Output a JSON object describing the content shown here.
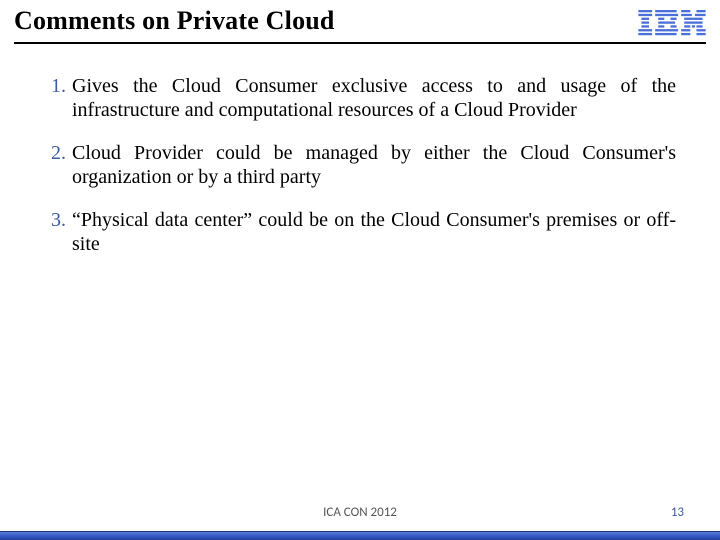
{
  "title": "Comments on Private Cloud",
  "logo": {
    "name": "IBM",
    "color": "#4a6fd8"
  },
  "items": [
    {
      "n": "1",
      "text": "Gives the Cloud Consumer exclusive access to and usage of the infrastructure and computational resources of a Cloud Provider"
    },
    {
      "n": "2",
      "text": "Cloud Provider could be managed by either the Cloud Consumer's organization or by a third party"
    },
    {
      "n": "3",
      "text": "“Physical data center” could be on the Cloud Consumer's premises or off-site"
    }
  ],
  "footer": "ICA CON 2012",
  "page": "13"
}
